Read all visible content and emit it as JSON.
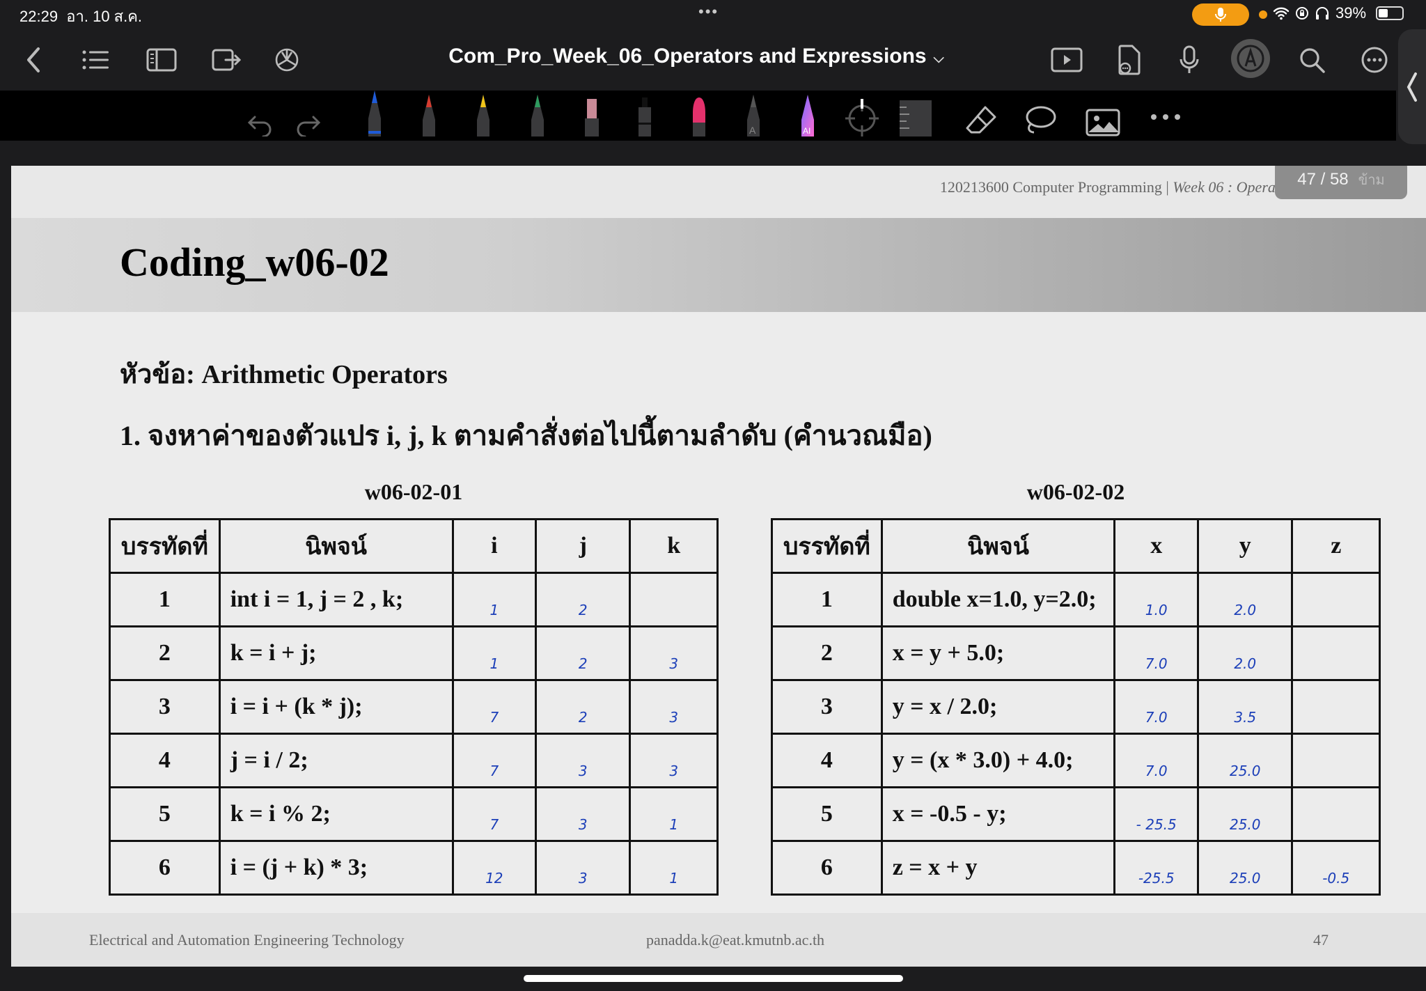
{
  "status_bar": {
    "time": "22:29",
    "date": "อา. 10 ส.ค.",
    "battery": "39%",
    "battery_level": 0.39
  },
  "toolbar": {
    "document_title": "Com_Pro_Week_06_Operators and Expressions"
  },
  "slide": {
    "header": "120213600 Computer Programming",
    "header_sep": "|",
    "header_week": "Week 06 : Operat",
    "page_indicator": "47 / 58",
    "skip_label": "ข้าม",
    "title": "Coding_w06-02",
    "topic": "หัวข้อ: Arithmetic Operators",
    "question": "1. จงหาค่าของตัวแปร i, j, k ตามคำสั่งต่อไปนี้ตามลำดับ (คำนวณมือ)",
    "table1": {
      "caption": "w06-02-01",
      "headers": [
        "บรรทัดที่",
        "นิพจน์",
        "i",
        "j",
        "k"
      ],
      "rows": [
        {
          "line": "1",
          "expr": "int i = 1, j = 2 , k;",
          "v1": "1",
          "v2": "2",
          "v3": ""
        },
        {
          "line": "2",
          "expr": "k = i + j;",
          "v1": "1",
          "v2": "2",
          "v3": "3"
        },
        {
          "line": "3",
          "expr": "i = i + (k * j);",
          "v1": "7",
          "v2": "2",
          "v3": "3"
        },
        {
          "line": "4",
          "expr": "j = i / 2;",
          "v1": "7",
          "v2": "3",
          "v3": "3"
        },
        {
          "line": "5",
          "expr": "k = i % 2;",
          "v1": "7",
          "v2": "3",
          "v3": "1"
        },
        {
          "line": "6",
          "expr": "i = (j + k) * 3;",
          "v1": "12",
          "v2": "3",
          "v3": "1"
        }
      ]
    },
    "table2": {
      "caption": "w06-02-02",
      "headers": [
        "บรรทัดที่",
        "นิพจน์",
        "x",
        "y",
        "z"
      ],
      "rows": [
        {
          "line": "1",
          "expr": "double x=1.0, y=2.0;",
          "v1": "1.0",
          "v2": "2.0",
          "v3": ""
        },
        {
          "line": "2",
          "expr": "x = y + 5.0;",
          "v1": "7.0",
          "v2": "2.0",
          "v3": ""
        },
        {
          "line": "3",
          "expr": "y = x / 2.0;",
          "v1": "7.0",
          "v2": "3.5",
          "v3": ""
        },
        {
          "line": "4",
          "expr": "y = (x * 3.0) + 4.0;",
          "v1": "7.0",
          "v2": "25.0",
          "v3": ""
        },
        {
          "line": "5",
          "expr": "x = -0.5 - y;",
          "v1": "- 25.5",
          "v2": "25.0",
          "v3": ""
        },
        {
          "line": "6",
          "expr": "z = x + y",
          "v1": "-25.5",
          "v2": "25.0",
          "v3": "-0.5"
        }
      ]
    },
    "footer": {
      "left": "Electrical and Automation Engineering Technology",
      "center": "panadda.k@eat.kmutnb.ac.th",
      "page": "47"
    }
  },
  "colors": {
    "accent_orange": "#f39c12",
    "handwriting_blue": "#1c3fb8"
  },
  "icons": [
    "back-icon",
    "list-icon",
    "sidebar-icon",
    "export-icon",
    "chatgpt-icon",
    "present-icon",
    "share-doc-icon",
    "microphone-icon",
    "pen-mode-icon",
    "search-icon",
    "more-icon",
    "undo-icon",
    "redo-icon",
    "lasso-icon",
    "image-icon",
    "eraser-icon",
    "ruler-icon"
  ]
}
